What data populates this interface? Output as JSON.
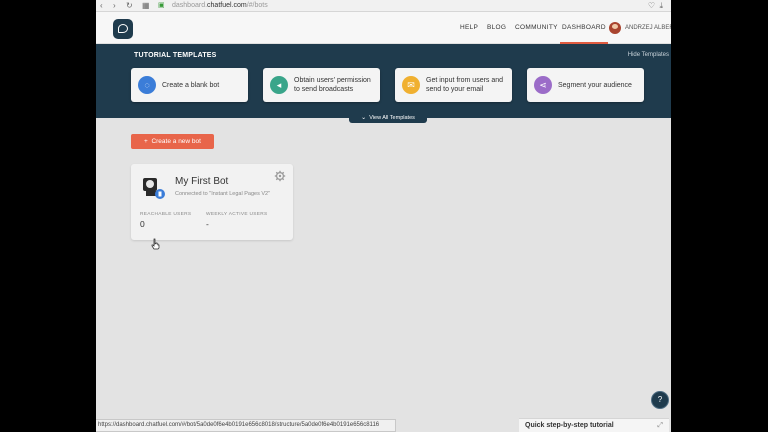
{
  "browser": {
    "url_prefix": "dashboard.",
    "url_domain": "chatfuel.com",
    "url_path": "/#/bots"
  },
  "header": {
    "menu": [
      "HELP",
      "BLOG",
      "COMMUNITY",
      "DASHBOARD"
    ],
    "active_menu": "DASHBOARD",
    "user_name": "ANDRZEJ ALBERT"
  },
  "tutorial": {
    "title": "TUTORIAL TEMPLATES",
    "hide_label": "Hide Templates",
    "view_all_label": "View All Templates",
    "cards": [
      {
        "label": "Create a blank bot",
        "icon": "chat-bubble-icon",
        "color": "#3b7dd8"
      },
      {
        "label": "Obtain users' permission to send broadcasts",
        "icon": "megaphone-icon",
        "color": "#3aa58a"
      },
      {
        "label": "Get input from users and send to your email",
        "icon": "envelope-icon",
        "color": "#f0b030"
      },
      {
        "label": "Segment your audience",
        "icon": "segment-icon",
        "color": "#9b6cc8"
      }
    ]
  },
  "main": {
    "create_button": "Create a new bot",
    "bot": {
      "name": "My First Bot",
      "connected": "Connected to \"Instant Legal Pages V2\"",
      "reachable_label": "REACHABLE USERS",
      "reachable_value": "0",
      "weekly_label": "WEEKLY ACTIVE USERS",
      "weekly_value": "-"
    }
  },
  "footer": {
    "quick_tutorial": "Quick step-by-step tutorial",
    "status_url": "https://dashboard.chatfuel.com/#/bot/5a0de0f6e4b0191e656c8018/structure/5a0de0f6e4b0191e656c8116"
  },
  "colors": {
    "brand": "#1f3b4d",
    "accent": "#e8654a"
  }
}
